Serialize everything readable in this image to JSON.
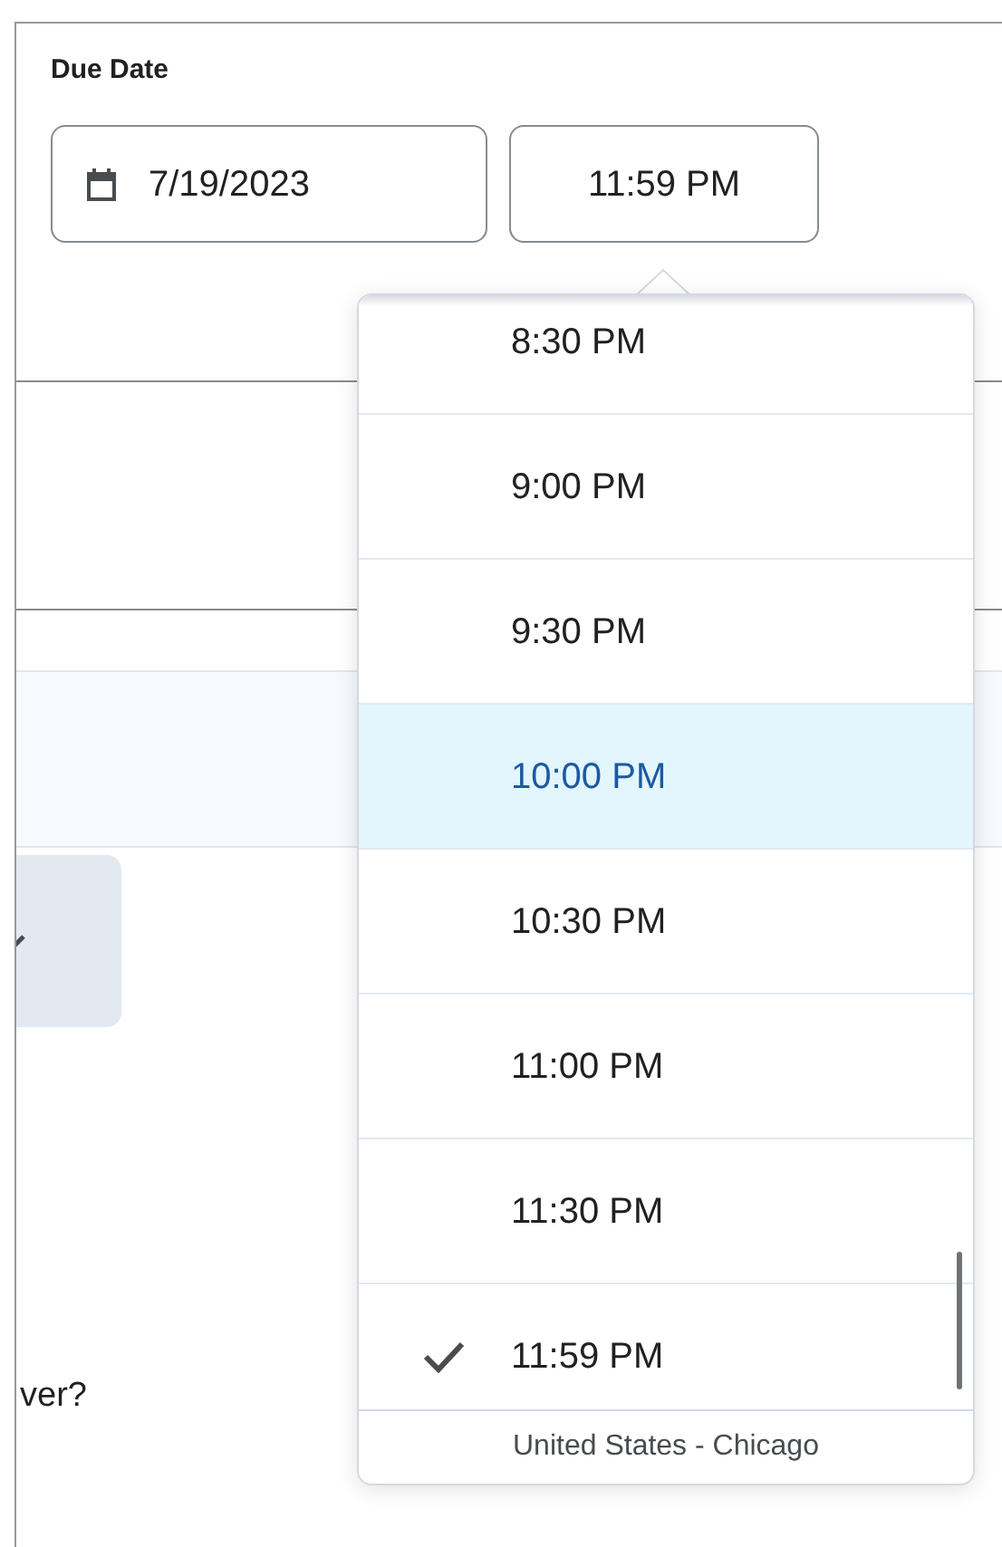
{
  "due_date": {
    "label": "Due Date",
    "date": "7/19/2023",
    "time": "11:59 PM"
  },
  "background": {
    "partial_text": "ver?"
  },
  "time_menu": {
    "options": [
      {
        "label": "8:30 PM",
        "selected": false,
        "highlighted": false
      },
      {
        "label": "9:00 PM",
        "selected": false,
        "highlighted": false
      },
      {
        "label": "9:30 PM",
        "selected": false,
        "highlighted": false
      },
      {
        "label": "10:00 PM",
        "selected": false,
        "highlighted": true
      },
      {
        "label": "10:30 PM",
        "selected": false,
        "highlighted": false
      },
      {
        "label": "11:00 PM",
        "selected": false,
        "highlighted": false
      },
      {
        "label": "11:30 PM",
        "selected": false,
        "highlighted": false
      },
      {
        "label": "11:59 PM",
        "selected": true,
        "highlighted": false
      }
    ],
    "timezone": "United States - Chicago"
  }
}
